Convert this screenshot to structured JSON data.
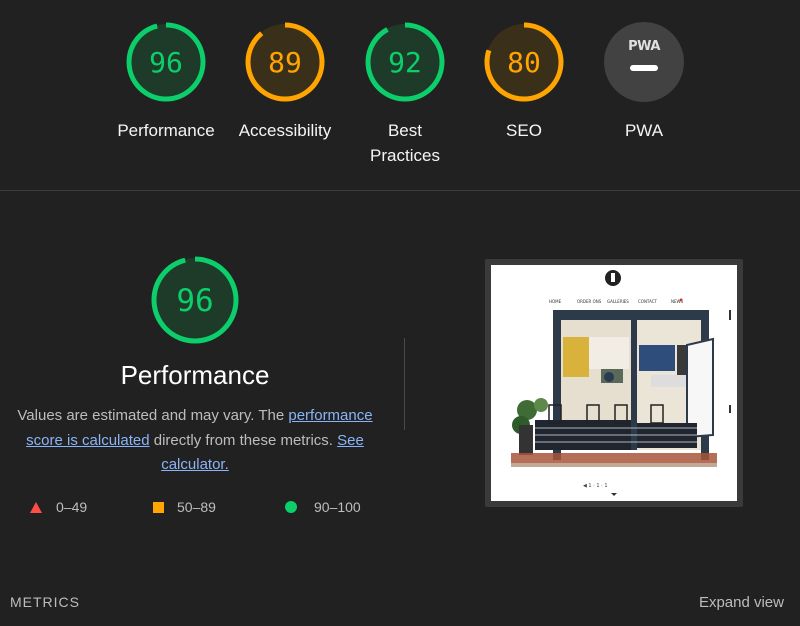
{
  "categories": [
    {
      "score": "96",
      "label": "Performance",
      "fraction": 0.96,
      "color": "#0cce6b",
      "fill": "#1e3a29"
    },
    {
      "score": "89",
      "label": "Accessibility",
      "fraction": 0.89,
      "color": "#ffa400",
      "fill": "#3a2f19"
    },
    {
      "score": "92",
      "label_line1": "Best",
      "label_line2": "Practices",
      "fraction": 0.92,
      "color": "#0cce6b",
      "fill": "#1e3a29"
    },
    {
      "score": "80",
      "label": "SEO",
      "fraction": 0.8,
      "color": "#ffa400",
      "fill": "#3a2f19"
    },
    {
      "badge": "PWA",
      "label": "PWA",
      "color": "#ffffff",
      "fill": "#424242"
    }
  ],
  "performance": {
    "score": "96",
    "fraction": 0.96,
    "title": "Performance",
    "desc_part1": "Values are estimated and may vary. The ",
    "desc_link1": "performance score is calculated",
    "desc_part2": " directly from these metrics. ",
    "desc_link2": "See calculator.",
    "color": "#0cce6b",
    "fill": "#1e3a29"
  },
  "legend": {
    "fail": "0–49",
    "average": "50–89",
    "pass": "90–100"
  },
  "thumbnail": {
    "nav": [
      "HOME",
      "ORDER ONS",
      "GALLERIES",
      "CONTACT",
      "NEWS"
    ],
    "pager": "◀ 1 · 1 · 1"
  },
  "footer": {
    "metrics_label": "METRICS",
    "expand_label": "Expand view"
  }
}
